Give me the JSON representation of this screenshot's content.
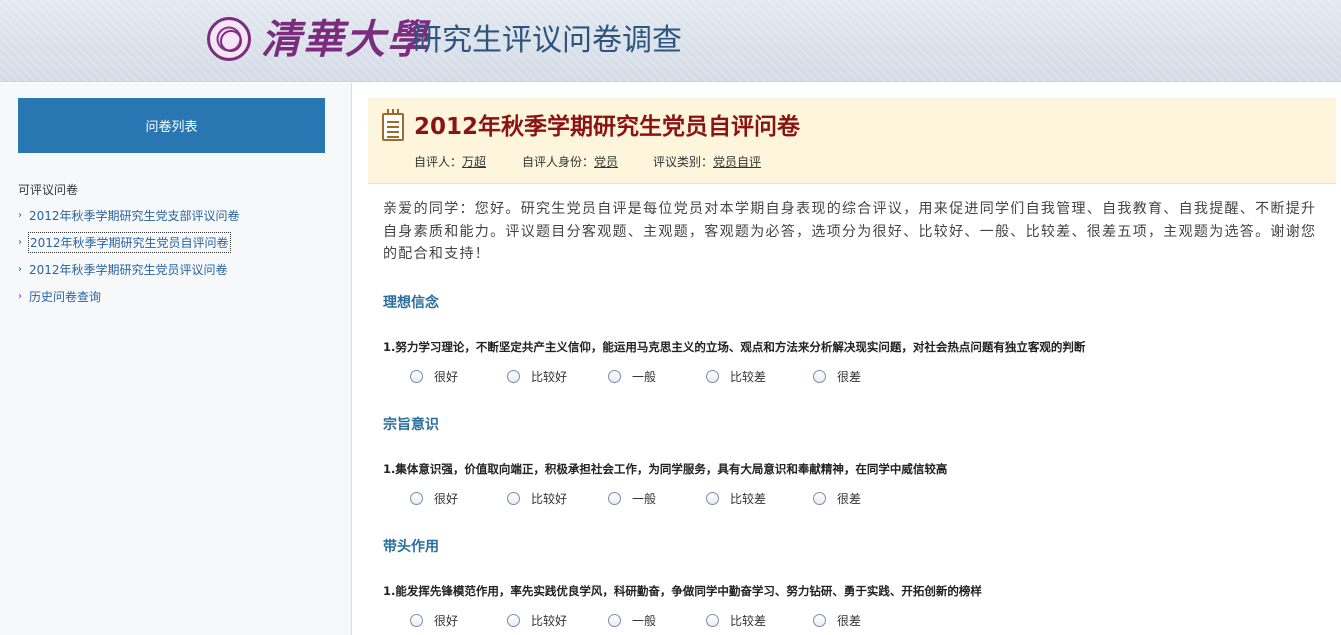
{
  "header": {
    "university_name": "清華大學",
    "site_title": "研究生评议问卷调查"
  },
  "sidebar": {
    "list_button": "问卷列表",
    "section_label": "可评议问卷",
    "items": [
      {
        "label": "2012年秋季学期研究生党支部评议问卷",
        "active": false
      },
      {
        "label": "2012年秋季学期研究生党员自评问卷",
        "active": true
      },
      {
        "label": "2012年秋季学期研究生党员评议问卷",
        "active": false
      },
      {
        "label": "历史问卷查询",
        "active": false
      }
    ]
  },
  "survey": {
    "title": "2012年秋季学期研究生党员自评问卷",
    "evaluator_label": "自评人：",
    "evaluator_value": "万超",
    "identity_label": "自评人身份：",
    "identity_value": "党员",
    "category_label": "评议类别：",
    "category_value": "党员自评",
    "intro": "亲爱的同学：您好。研究生党员自评是每位党员对本学期自身表现的综合评议，用来促进同学们自我管理、自我教育、自我提醒、不断提升自身素质和能力。评议题目分客观题、主观题，客观题为必答，选项分为很好、比较好、一般、比较差、很差五项，主观题为选答。谢谢您的配合和支持！",
    "options": [
      "很好",
      "比较好",
      "一般",
      "比较差",
      "很差"
    ],
    "sections": [
      {
        "heading": "理想信念",
        "question": "1.努力学习理论，不断坚定共产主义信仰，能运用马克思主义的立场、观点和方法来分析解决现实问题，对社会热点问题有独立客观的判断"
      },
      {
        "heading": "宗旨意识",
        "question": "1.集体意识强，价值取向端正，积极承担社会工作，为同学服务，具有大局意识和奉献精神，在同学中威信较高"
      },
      {
        "heading": "带头作用",
        "question": "1.能发挥先锋模范作用，率先实践优良学风，科研勤奋，争做同学中勤奋学习、努力钻研、勇于实践、开拓创新的榜样"
      }
    ]
  }
}
